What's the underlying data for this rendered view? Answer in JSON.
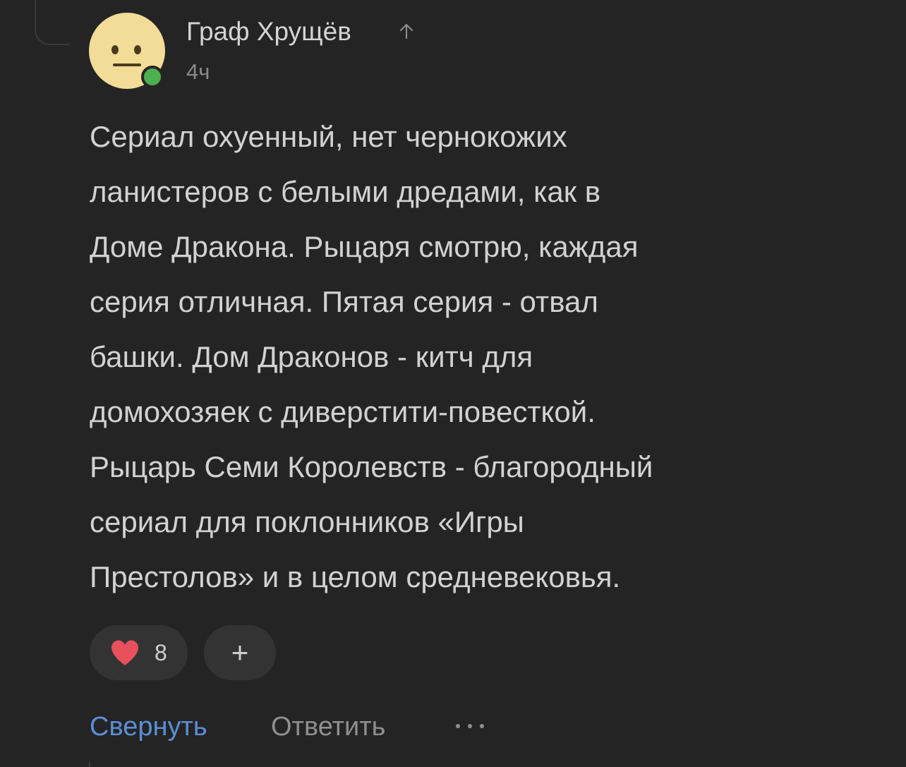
{
  "comment": {
    "author": "Граф Хрущёв",
    "timestamp": "4ч",
    "text_lines": [
      "Сериал охуенный, нет чернокожих",
      "ланистеров с белыми дредами, как в",
      "Доме Дракона. Рыцаря смотрю, каждая",
      "серия отличная. Пятая серия - отвал",
      "башки. Дом Драконов - китч для",
      "домохозяек с диверстити-повесткой.",
      "Рыцарь Семи Королевств - благородный",
      "сериал для поклонников «Игры",
      "Престолов» и в целом средневековья."
    ]
  },
  "reactions": {
    "like_count": "8",
    "add_label": "+"
  },
  "actions": {
    "collapse_label": "Свернуть",
    "reply_label": "Ответить",
    "more_label": "···"
  },
  "colors": {
    "background": "#242424",
    "link_blue": "#5b8fd6",
    "heart_red": "#e8505b",
    "online_green": "#4caf50",
    "avatar_yellow": "#f2dc97"
  },
  "icons": {
    "avatar": "neutral-face-emoji",
    "author_badge": "arrow-up-icon",
    "like": "heart-icon",
    "more": "ellipsis-icon"
  }
}
